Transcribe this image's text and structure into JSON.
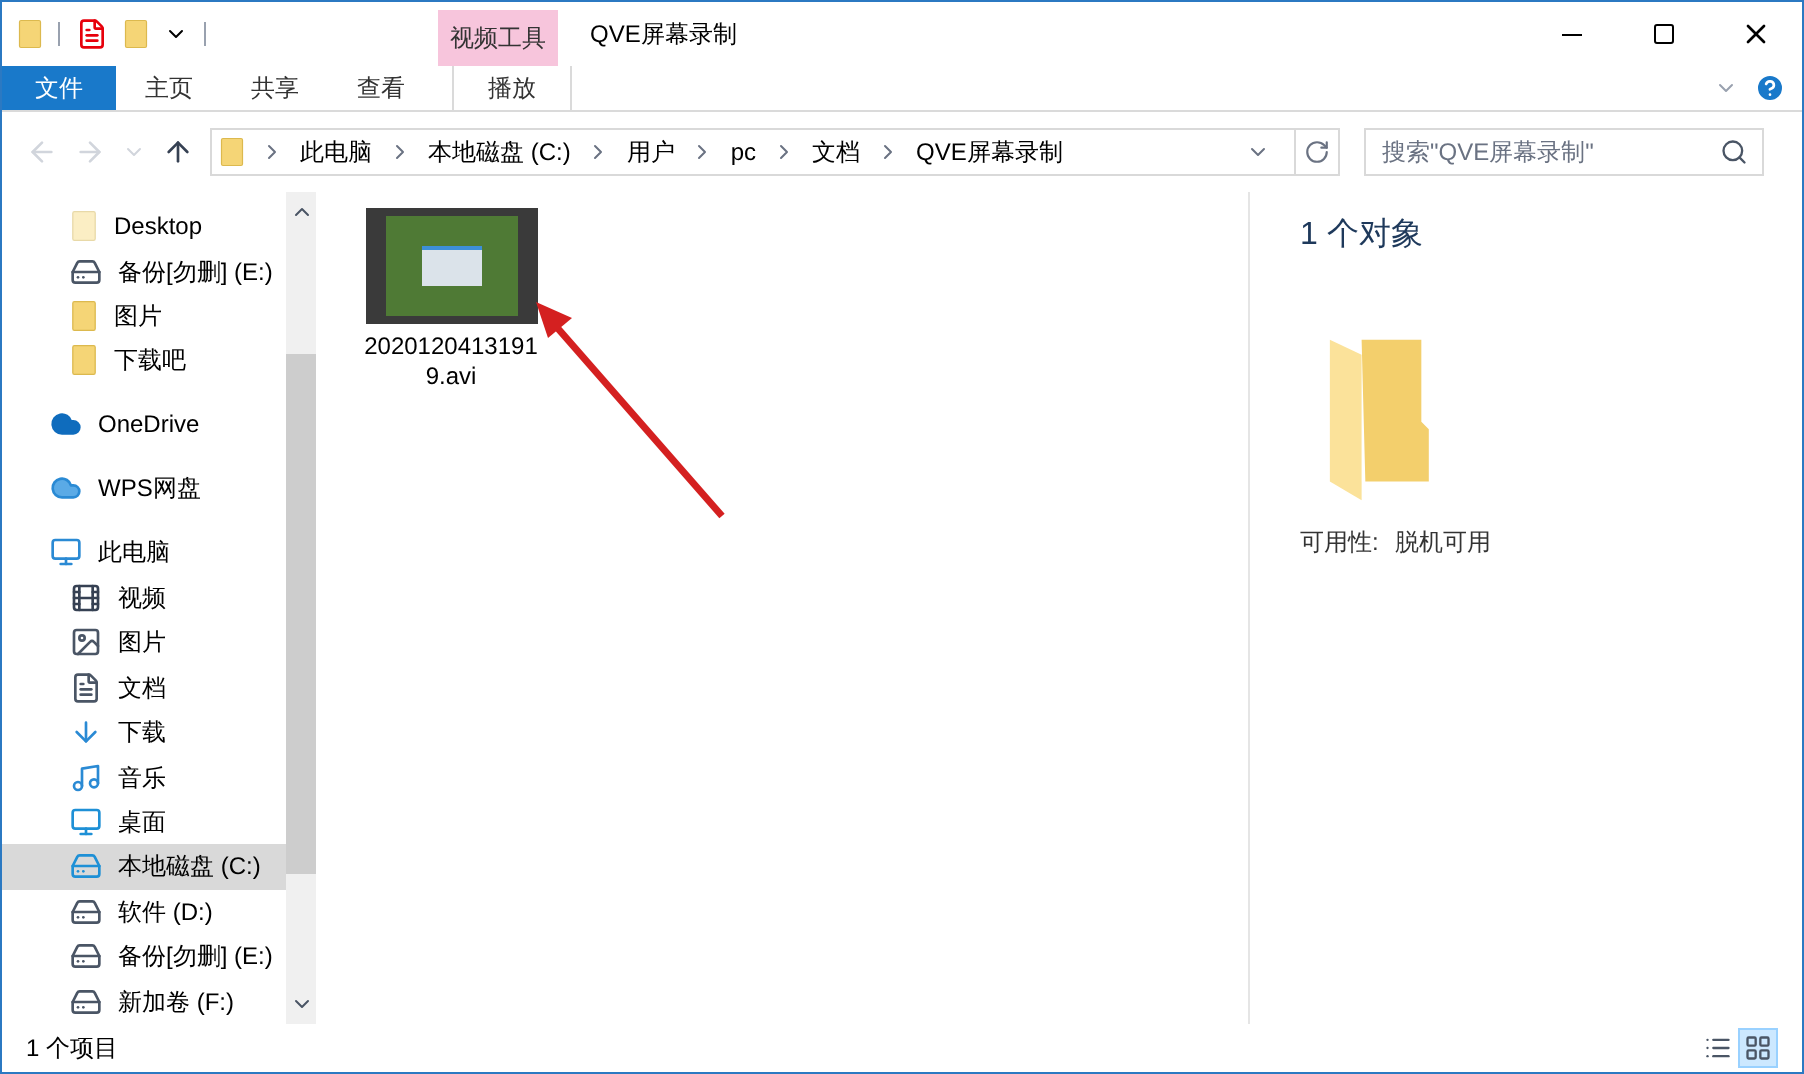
{
  "window": {
    "title": "QVE屏幕录制",
    "context_group": "视频工具"
  },
  "ribbon_tabs": [
    {
      "label": "文件",
      "kind": "file",
      "selected": false
    },
    {
      "label": "主页",
      "kind": "tab",
      "selected": false
    },
    {
      "label": "共享",
      "kind": "tab",
      "selected": false
    },
    {
      "label": "查看",
      "kind": "tab",
      "selected": false
    },
    {
      "label": "播放",
      "kind": "context",
      "selected": false
    }
  ],
  "address_bar": {
    "path": [
      "此电脑",
      "本地磁盘 (C:)",
      "用户",
      "pc",
      "文档",
      "QVE屏幕录制"
    ]
  },
  "search": {
    "placeholder": "搜索\"QVE屏幕录制\""
  },
  "sidebar": {
    "quick_access": [
      {
        "label": "Desktop",
        "kind": "folder-light",
        "selected": false
      },
      {
        "label": "备份[勿删] (E:)",
        "kind": "drive",
        "selected": false
      },
      {
        "label": "图片",
        "kind": "folder",
        "selected": false
      },
      {
        "label": "下载吧",
        "kind": "folder",
        "selected": false
      }
    ],
    "items": [
      {
        "label": "OneDrive",
        "kind": "cloud",
        "selected": false
      },
      {
        "label": "WPS网盘",
        "kind": "cloud-light",
        "selected": false
      },
      {
        "label": "此电脑",
        "kind": "pc",
        "selected": false,
        "children": [
          {
            "label": "视频",
            "kind": "video",
            "selected": false
          },
          {
            "label": "图片",
            "kind": "pictures",
            "selected": false
          },
          {
            "label": "文档",
            "kind": "docs",
            "selected": false
          },
          {
            "label": "下载",
            "kind": "download",
            "selected": false
          },
          {
            "label": "音乐",
            "kind": "music",
            "selected": false
          },
          {
            "label": "桌面",
            "kind": "desktop",
            "selected": false
          },
          {
            "label": "本地磁盘 (C:)",
            "kind": "system-drive",
            "selected": true
          },
          {
            "label": "软件 (D:)",
            "kind": "drive",
            "selected": false
          },
          {
            "label": "备份[勿删] (E:)",
            "kind": "drive",
            "selected": false
          },
          {
            "label": "新加卷 (F:)",
            "kind": "drive",
            "selected": false
          }
        ]
      }
    ]
  },
  "files": [
    {
      "name": "20201204131919.avi",
      "selected": false
    }
  ],
  "details": {
    "title": "1 个对象",
    "property_label": "可用性:",
    "property_value": "脱机可用"
  },
  "status_bar": {
    "count": "1 个项目",
    "views": [
      {
        "kind": "details",
        "selected": false
      },
      {
        "kind": "large-icons",
        "selected": true
      }
    ]
  }
}
